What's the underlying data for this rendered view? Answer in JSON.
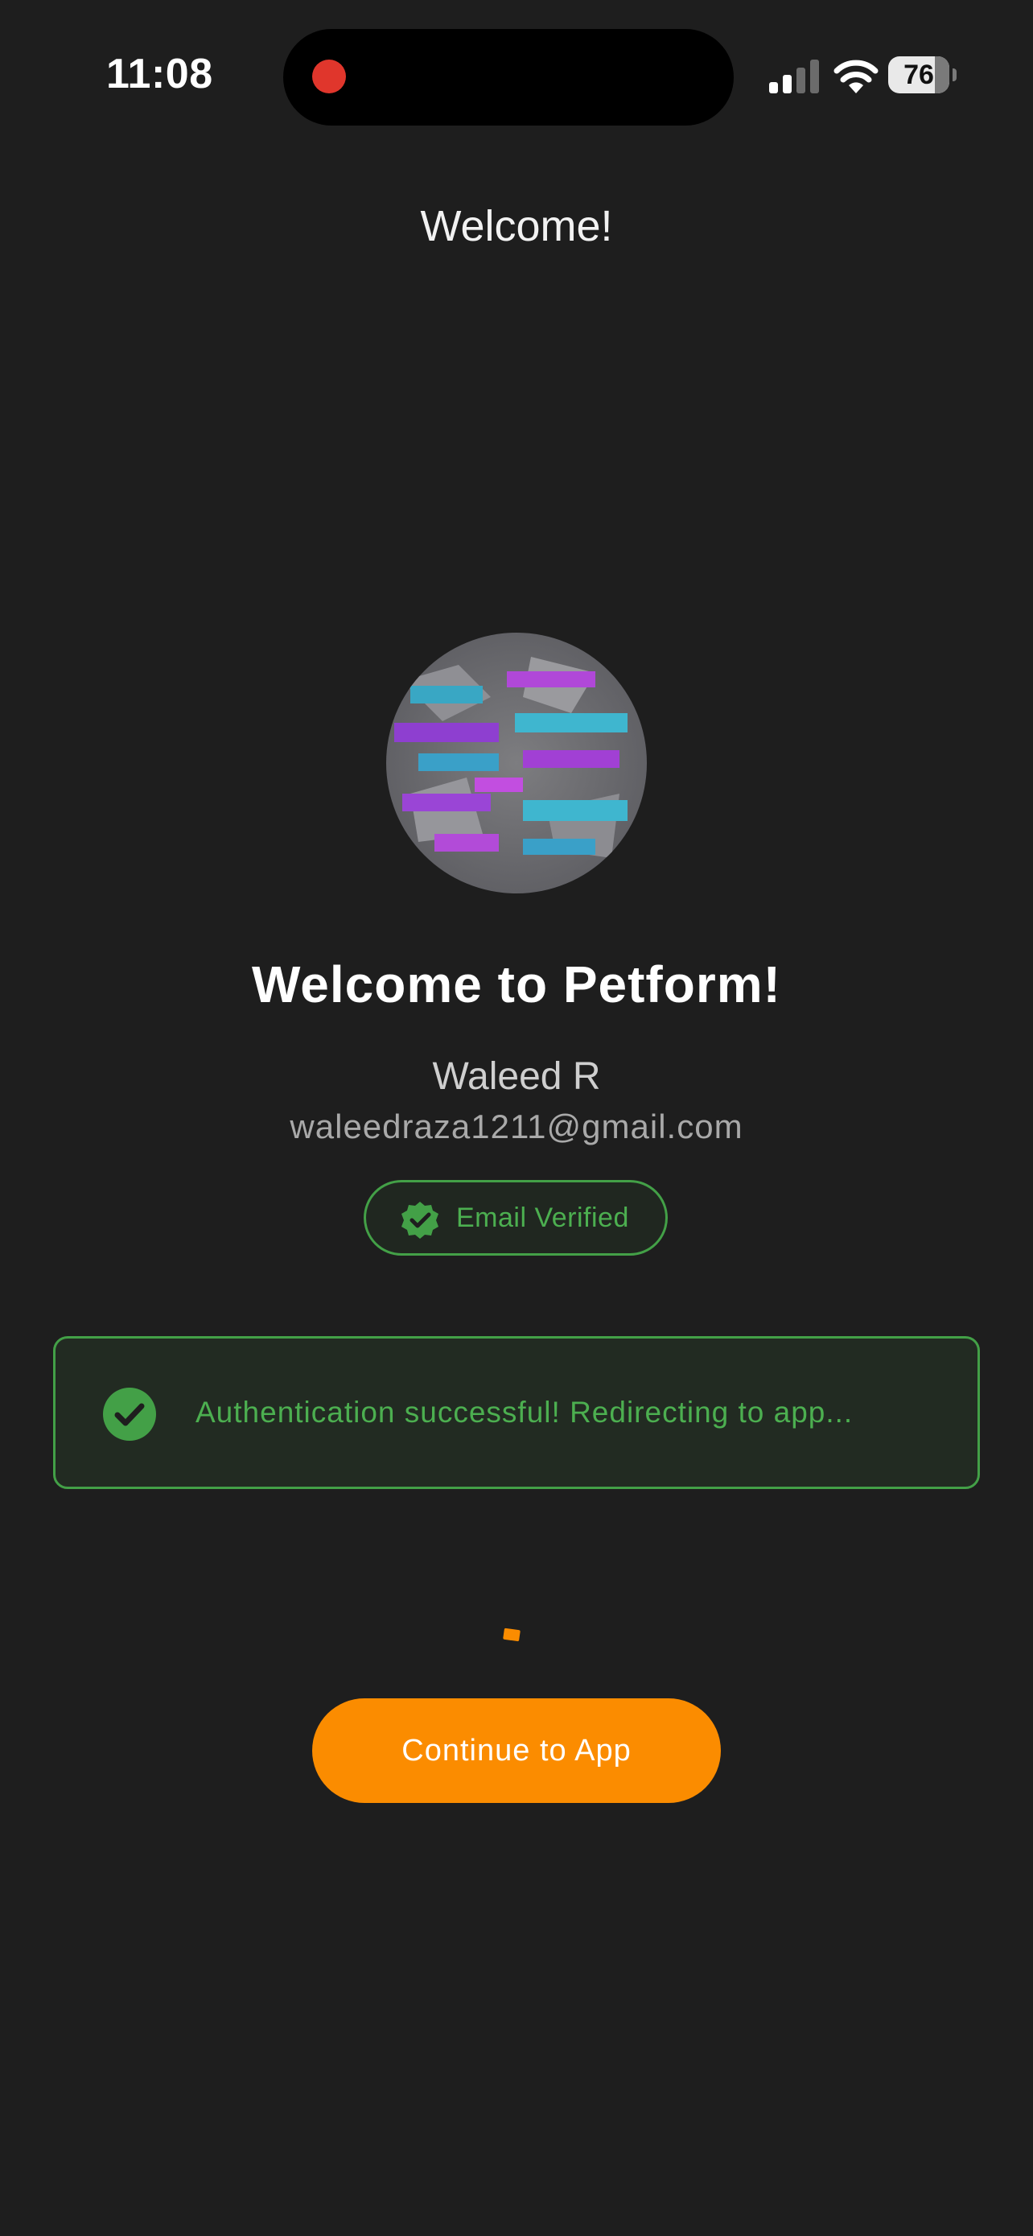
{
  "status_bar": {
    "time": "11:08",
    "battery": "76",
    "recording_indicator_color": "#e0362c",
    "icons": [
      "signal-icon",
      "wifi-icon",
      "battery-icon"
    ]
  },
  "header": {
    "title": "Welcome!"
  },
  "profile": {
    "heading": "Welcome to Petform!",
    "name": "Waleed R",
    "email": "waleedraza1211@gmail.com"
  },
  "badge": {
    "label": "Email Verified",
    "icon": "verified-badge-icon"
  },
  "banner": {
    "message": "Authentication successful! Redirecting to app...",
    "icon": "check-circle-icon"
  },
  "actions": {
    "continue_label": "Continue to App"
  },
  "colors": {
    "background": "#1e1e1e",
    "accent": "#fb8c00",
    "success": "#4caf50"
  }
}
